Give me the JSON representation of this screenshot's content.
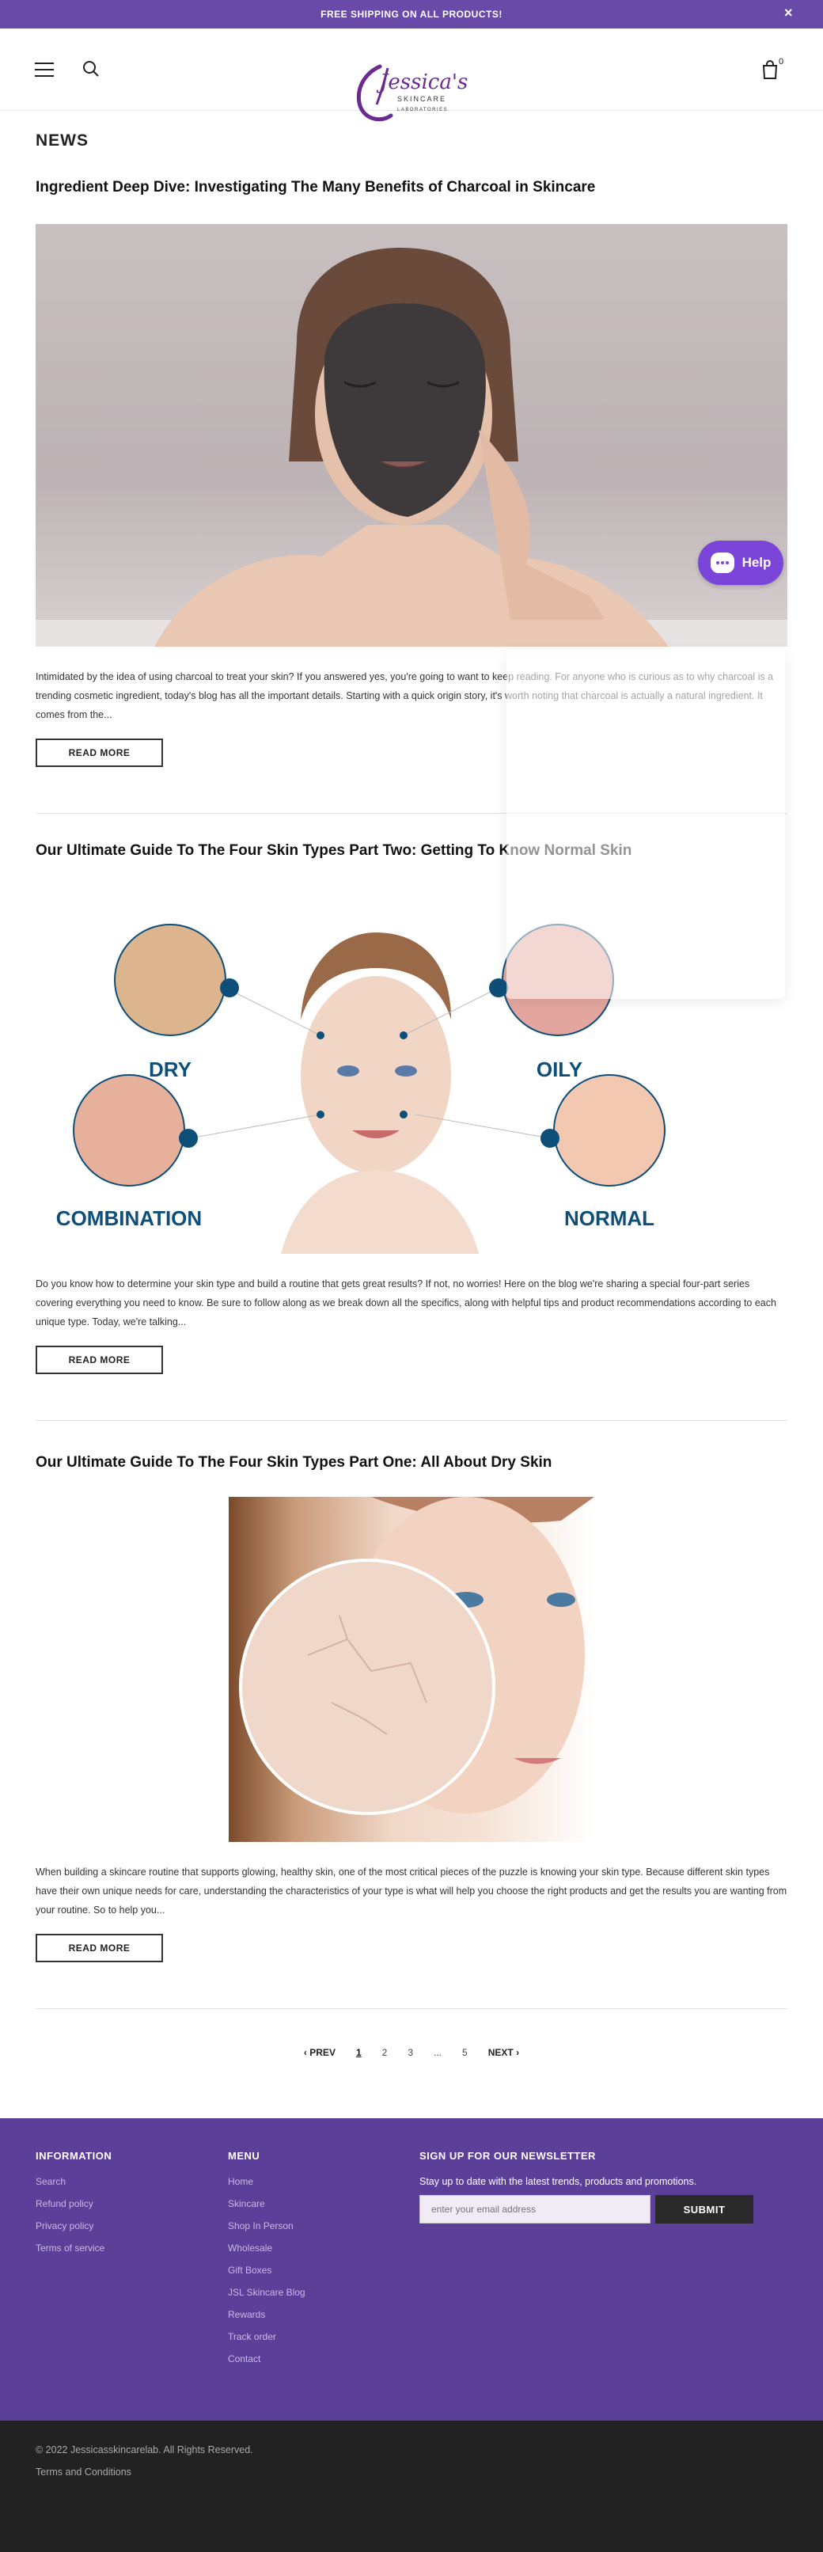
{
  "announcement": {
    "text": "FREE SHIPPING ON ALL PRODUCTS!",
    "close": "×"
  },
  "header": {
    "logo_name": "Jessica's",
    "logo_line1": "SKINCARE",
    "logo_line2": "LABORATORIES",
    "cart_count": "0"
  },
  "page_title": "NEWS",
  "articles": [
    {
      "title": "Ingredient Deep Dive: Investigating The Many Benefits of Charcoal in Skincare",
      "excerpt": "Intimidated by the idea of using charcoal to treat your skin? If you answered yes, you're going to want to keep reading. For anyone who is curious as to why charcoal is a trending cosmetic ingredient, today's blog has all the important details.   Starting with a quick origin story, it's worth noting that charcoal is actually a natural ingredient. It comes from the...",
      "read_more": "READ MORE"
    },
    {
      "title": "Our Ultimate Guide To The Four Skin Types Part Two: Getting To Know Normal Skin",
      "excerpt": "Do you know how to determine your skin type and build a routine that gets great results? If not, no worries! Here on the blog we're sharing a special four-part series covering everything you need to know. Be sure to follow along as we break down all the specifics, along with helpful tips and product recommendations according to each unique type. Today, we're talking...",
      "read_more": "READ MORE",
      "image_labels": {
        "dry": "DRY",
        "oily": "OILY",
        "combination": "COMBINATION",
        "normal": "NORMAL"
      }
    },
    {
      "title": "Our Ultimate Guide To The Four Skin Types Part One: All About Dry Skin",
      "excerpt": "When building a skincare routine that supports glowing, healthy skin, one of the most critical pieces of the puzzle is knowing your skin type. Because different skin types have their own unique needs for care, understanding the characteristics of your type is what will help you choose the right products and get the results you are wanting from your routine.  So to help you...",
      "read_more": "READ MORE"
    }
  ],
  "pagination": {
    "prev": "PREV",
    "pages": [
      "1",
      "2",
      "3",
      "...",
      "5"
    ],
    "next": "NEXT"
  },
  "help_button": "Help",
  "footer": {
    "information": {
      "heading": "INFORMATION",
      "links": [
        "Search",
        "Refund policy",
        "Privacy policy",
        "Terms of service"
      ]
    },
    "menu": {
      "heading": "MENU",
      "links": [
        "Home",
        "Skincare",
        "Shop In Person",
        "Wholesale",
        "Gift Boxes",
        "JSL Skincare Blog",
        "Rewards",
        "Track order",
        "Contact"
      ]
    },
    "newsletter": {
      "heading": "SIGN UP FOR OUR NEWSLETTER",
      "text": "Stay up to date with the latest trends, products and promotions.",
      "placeholder": "enter your email address",
      "submit": "SUBMIT"
    }
  },
  "bottom": {
    "copyright": "© 2022 Jessicasskincarelab. All Rights Reserved.",
    "terms": "Terms and Conditions"
  },
  "colors": {
    "brand_purple": "#5c3f98",
    "announce_purple": "#6a4aa8",
    "help_purple": "#7a45d8",
    "skin_blue": "#0e4f7a"
  }
}
